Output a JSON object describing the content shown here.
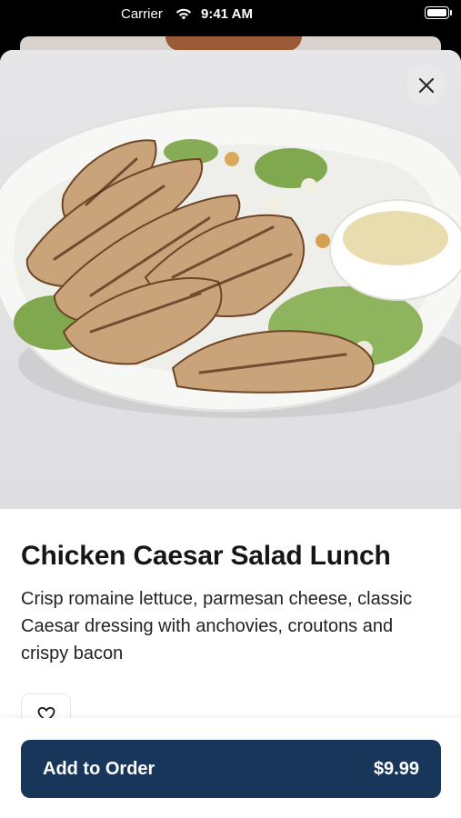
{
  "status_bar": {
    "carrier": "Carrier",
    "time": "9:41 AM",
    "wifi_icon": "wifi-icon",
    "battery_icon": "battery-icon"
  },
  "item": {
    "name": "Chicken Caesar Salad Lunch",
    "description": "Crisp romaine lettuce, parmesan cheese, classic Caesar dressing with anchovies, croutons and crispy bacon",
    "photo_icon": "salad-photo"
  },
  "actions": {
    "close_icon": "close-icon",
    "favorite_icon": "heart-icon",
    "add_label": "Add to Order",
    "price": "$9.99"
  },
  "colors": {
    "primary": "#18365a",
    "photo_bg": "#e3e3e6"
  }
}
